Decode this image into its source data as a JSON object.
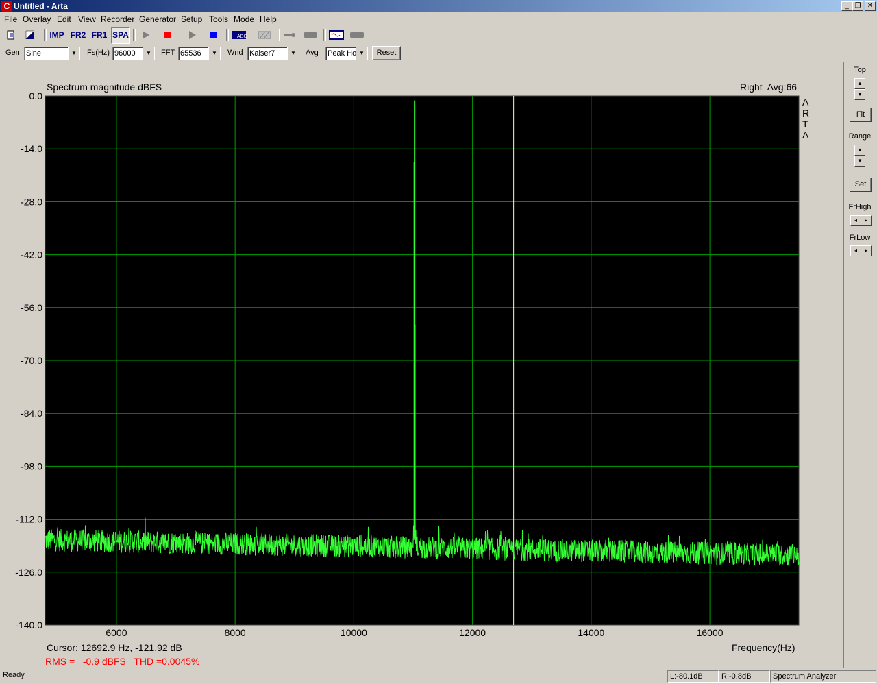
{
  "window": {
    "title": "Untitled - Arta",
    "app_icon": "arta-icon"
  },
  "menu": [
    "File",
    "Overlay",
    "Edit",
    "View",
    "Recorder",
    "Generator",
    "Setup",
    "Tools",
    "Mode",
    "Help"
  ],
  "toolbar": {
    "imp": "IMP",
    "fr2": "FR2",
    "fr1": "FR1",
    "spa": "SPA"
  },
  "controls": {
    "gen_label": "Gen",
    "gen_value": "Sine",
    "fs_label": "Fs(Hz)",
    "fs_value": "96000",
    "fft_label": "FFT",
    "fft_value": "65536",
    "wnd_label": "Wnd",
    "wnd_value": "Kaiser7",
    "avg_label": "Avg",
    "avg_value": "Peak Hol",
    "reset_label": "Reset"
  },
  "right_panel": {
    "top_label": "Top",
    "fit_label": "Fit",
    "range_label": "Range",
    "set_label": "Set",
    "frhigh_label": "FrHigh",
    "frlow_label": "FrLow"
  },
  "plot": {
    "title": "Spectrum magnitude dBFS",
    "channel_info": "Right  Avg:66",
    "brand": [
      "A",
      "R",
      "T",
      "A"
    ],
    "cursor_text": "Cursor: 12692.9 Hz, -121.92 dB",
    "measure_text": "RMS =   -0.9 dBFS   THD =0.0045%",
    "colors": {
      "background": "#000000",
      "grid": "#00a000",
      "trace": "#33ff33",
      "cursor": "#ffffa0",
      "measure": "#ff0000"
    }
  },
  "chart_data": {
    "type": "line",
    "title": "Spectrum magnitude dBFS",
    "xlabel": "Frequency(Hz)",
    "ylabel": "",
    "xlim": [
      4800,
      17500
    ],
    "ylim": [
      -140,
      0
    ],
    "x_ticks": [
      "6000",
      "8000",
      "10000",
      "12000",
      "14000",
      "16000"
    ],
    "y_ticks": [
      "0.0",
      "-14.0",
      "-28.0",
      "-42.0",
      "-56.0",
      "-70.0",
      "-84.0",
      "-98.0",
      "-112.0",
      "-126.0",
      "-140.0"
    ],
    "grid": true,
    "noise_floor_db": [
      -117.5,
      -121.5
    ],
    "peak": {
      "x": 11025,
      "y": -1.2
    },
    "peak_side": {
      "x": 11025,
      "y": -17.5
    },
    "peak_shoulder": {
      "x": 11035,
      "y": -60.5
    },
    "cursor_x": 12692.9,
    "series": [
      {
        "name": "Right",
        "color": "#33ff33"
      }
    ]
  },
  "status": {
    "ready": "Ready",
    "left": "L:-80.1dB",
    "right": "R:-0.8dB",
    "mode": "Spectrum Analyzer"
  }
}
